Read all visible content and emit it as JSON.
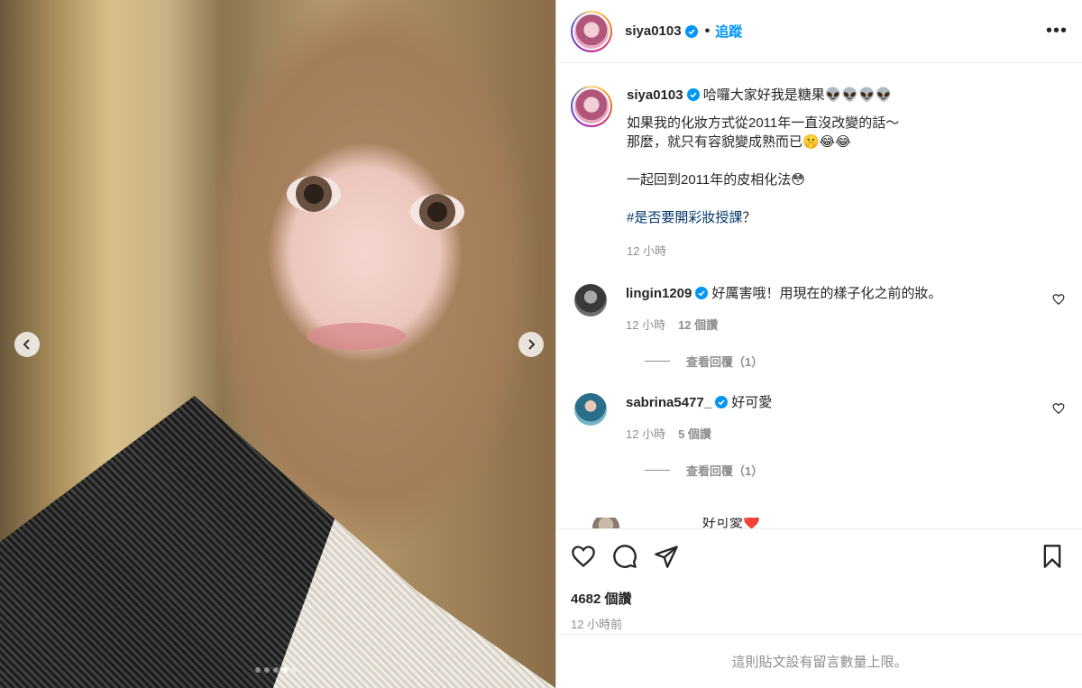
{
  "post": {
    "username": "siya0103",
    "separator": "•",
    "follow_label": "追蹤",
    "more_label": "•••",
    "caption_greeting": "哈囉大家好我是糖果👽👽👽👽",
    "caption_body": "如果我的化妝方式從2011年一直沒改變的話～\n那麼，就只有容貌變成熟而已🤫😂😂\n\n一起回到2011年的皮相化法😳",
    "hashtag": "#是否要開彩妝授課",
    "hashtag_suffix": "？",
    "caption_time": "12 小時"
  },
  "carousel": {
    "dot_count": 5,
    "active_dot": 3
  },
  "comments": [
    {
      "username": "lingin1209",
      "text": "好厲害哦！用現在的樣子化之前的妝。",
      "time": "12 小時",
      "likes": "12 個讚",
      "replies": "查看回覆（1）"
    },
    {
      "username": "sabrina5477_",
      "text": "好可愛",
      "time": "12 小時",
      "likes": "5 個讚",
      "replies": "查看回覆（1）"
    }
  ],
  "partial_comment_text": "好可愛❤️",
  "stats": {
    "views": "4682 個讚",
    "posted": "12 小時前"
  },
  "footer_text": "這則貼文設有留言數量上限。",
  "colors": {
    "link_blue": "#0095f6",
    "hashtag_blue": "#00376b",
    "verified_blue": "#0095f6",
    "muted_gray": "#8e8e8e"
  },
  "icons": [
    "chevron-left-icon",
    "chevron-right-icon",
    "verified-icon",
    "more-icon",
    "heart-icon",
    "comment-icon",
    "share-icon",
    "bookmark-icon"
  ]
}
